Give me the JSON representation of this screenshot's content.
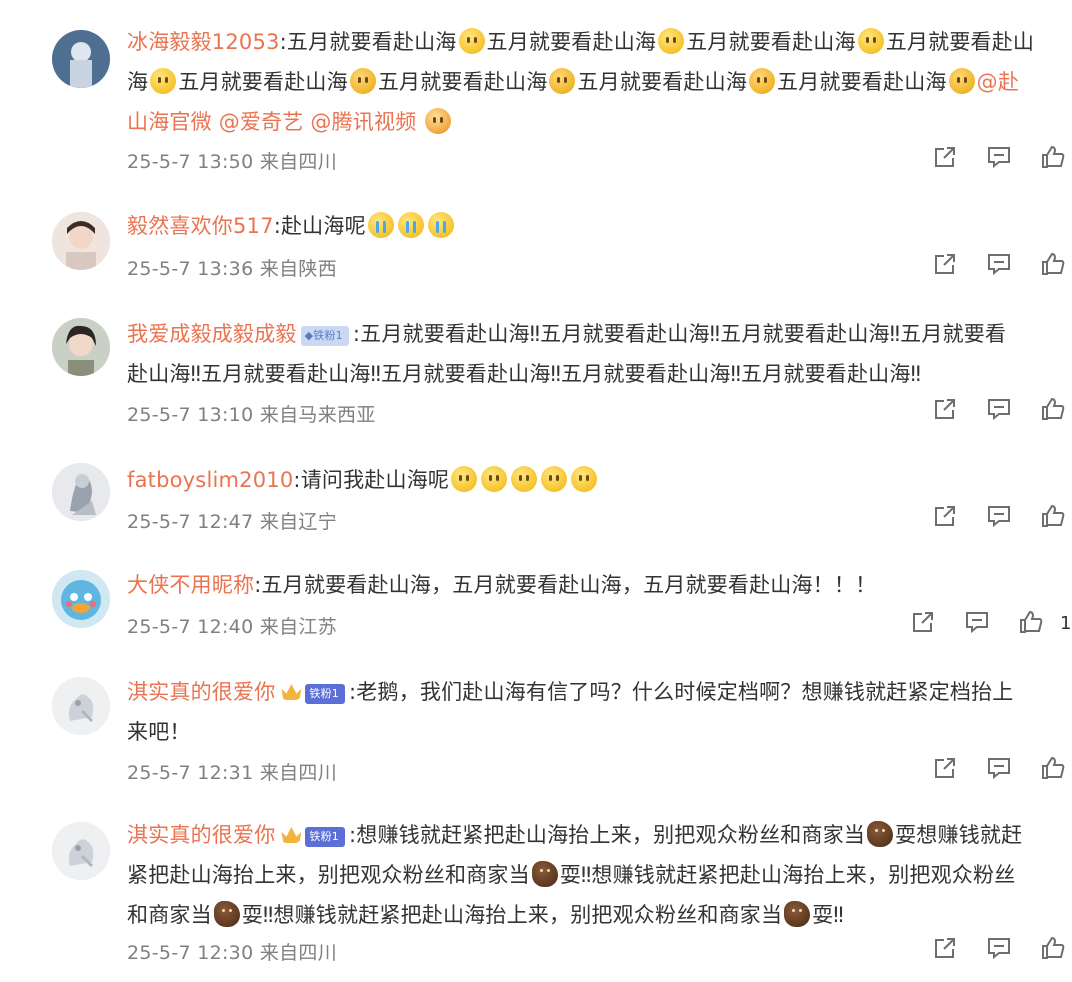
{
  "comments": [
    {
      "username": "冰海毅毅12053",
      "colon": ":",
      "segments": [
        {
          "t": "五月就要看赴山海"
        },
        {
          "e": "smile"
        },
        {
          "t": "五月就要看赴山海"
        },
        {
          "e": "smile"
        },
        {
          "t": "五月就要看赴山海"
        },
        {
          "e": "smile"
        },
        {
          "t": "五月就要看赴山"
        }
      ],
      "line2": [
        {
          "t": "海"
        },
        {
          "e": "smile"
        },
        {
          "t": "五月就要看赴山海"
        },
        {
          "e": "sad"
        },
        {
          "t": "五月就要看赴山海"
        },
        {
          "e": "sad"
        },
        {
          "t": "五月就要看赴山海"
        },
        {
          "e": "sad"
        },
        {
          "t": "五月就要看赴山海"
        },
        {
          "e": "sad"
        },
        {
          "at": "@赴"
        }
      ],
      "line3": [
        {
          "at": "山海官微"
        },
        {
          "t": " "
        },
        {
          "at": "@爱奇艺"
        },
        {
          "t": " "
        },
        {
          "at": "@腾讯视频"
        },
        {
          "t": " "
        },
        {
          "e": "love"
        }
      ],
      "date": "25-5-7 13:50",
      "location": "来自四川"
    },
    {
      "username": "毅然喜欢你517",
      "colon": ":",
      "segments": [
        {
          "t": "赴山海呢"
        },
        {
          "e": "cry"
        },
        {
          "e": "cry"
        },
        {
          "e": "cry"
        }
      ],
      "date": "25-5-7 13:36",
      "location": "来自陕西"
    },
    {
      "username": "我爱成毅成毅成毅",
      "badge": "铁粉1",
      "colon": ":",
      "segments": [
        {
          "t": "五月就要看赴山海‼五月就要看赴山海‼五月就要看赴山海‼五月就要看"
        }
      ],
      "line2": [
        {
          "t": "赴山海‼五月就要看赴山海‼五月就要看赴山海‼五月就要看赴山海‼五月就要看赴山海‼"
        }
      ],
      "date": "25-5-7 13:10",
      "location": "来自马来西亚"
    },
    {
      "username": "fatboyslim2010",
      "colon": ":",
      "segments": [
        {
          "t": "请问我赴山海呢"
        },
        {
          "e": "smile"
        },
        {
          "e": "smile"
        },
        {
          "e": "smile"
        },
        {
          "e": "smile"
        },
        {
          "e": "smile"
        }
      ],
      "date": "25-5-7 12:47",
      "location": "来自辽宁"
    },
    {
      "username": "大侠不用昵称",
      "colon": ":",
      "segments": [
        {
          "t": "五月就要看赴山海，五月就要看赴山海，五月就要看赴山海！！！"
        }
      ],
      "date": "25-5-7 12:40",
      "location": "来自江苏",
      "like_count": "1"
    },
    {
      "username": "淇实真的很爱你",
      "badge": "铁粉1",
      "colon": ":",
      "segments": [
        {
          "t": "老鹅，我们赴山海有信了吗？什么时候定档啊？想赚钱就赶紧定档抬上"
        }
      ],
      "line2": [
        {
          "t": "来吧！"
        }
      ],
      "date": "25-5-7 12:31",
      "location": "来自四川"
    },
    {
      "username": "淇实真的很爱你",
      "badge": "铁粉1",
      "colon": ":",
      "segments": [
        {
          "t": "想赚钱就赶紧把赴山海抬上来，别把观众粉丝和商家当"
        },
        {
          "e": "squirrel"
        },
        {
          "t": "耍想赚钱就赶"
        }
      ],
      "line2": [
        {
          "t": "紧把赴山海抬上来，别把观众粉丝和商家当"
        },
        {
          "e": "squirrel"
        },
        {
          "t": "耍‼想赚钱就赶紧把赴山海抬上来，别把观众粉丝"
        }
      ],
      "line3": [
        {
          "t": "和商家当"
        },
        {
          "e": "squirrel"
        },
        {
          "t": "耍‼想赚钱就赶紧把赴山海抬上来，别把观众粉丝和商家当"
        },
        {
          "e": "squirrel"
        },
        {
          "t": "耍‼"
        }
      ],
      "date": "25-5-7 12:30",
      "location": "来自四川"
    }
  ],
  "icons": {
    "share": "share-icon",
    "comment": "comment-icon",
    "like": "like-icon"
  },
  "colors": {
    "username": "#eb7350",
    "meta": "#808080",
    "icon": "#6e6e6e"
  }
}
